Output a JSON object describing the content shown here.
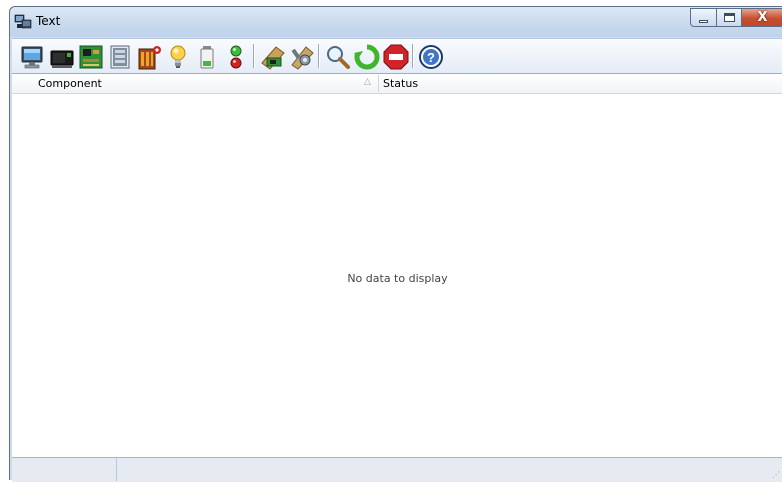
{
  "window": {
    "title": "Text",
    "app_icon": "computer-network-icon",
    "controls": [
      "minimize-icon",
      "maximize-icon",
      "close-icon"
    ],
    "close_glyph": "X"
  },
  "toolbar": {
    "buttons": [
      {
        "name": "monitor-icon"
      },
      {
        "name": "computer-black-icon"
      },
      {
        "name": "circuit-board-icon"
      },
      {
        "name": "memory-module-icon"
      },
      {
        "name": "server-rack-icon"
      },
      {
        "name": "lightbulb-icon"
      },
      {
        "name": "battery-icon"
      },
      {
        "name": "traffic-light-icon"
      },
      {
        "name": "network-card-icon"
      },
      {
        "name": "settings-tools-icon"
      },
      {
        "name": "search-icon"
      },
      {
        "name": "refresh-icon"
      },
      {
        "name": "stop-icon"
      },
      {
        "name": "help-icon"
      }
    ]
  },
  "grid": {
    "columns": [
      {
        "label": "Component",
        "sort": "ascending",
        "sort_glyph": "△"
      },
      {
        "label": "Status"
      }
    ],
    "empty_message": "No data to display"
  },
  "statusbar": {
    "panes": [
      "",
      ""
    ]
  },
  "colors": {
    "title_bar": "#c9daee",
    "close_button": "#c74f30",
    "toolbar_bg": "#e4ecf6",
    "grid_bg": "#ffffff"
  }
}
